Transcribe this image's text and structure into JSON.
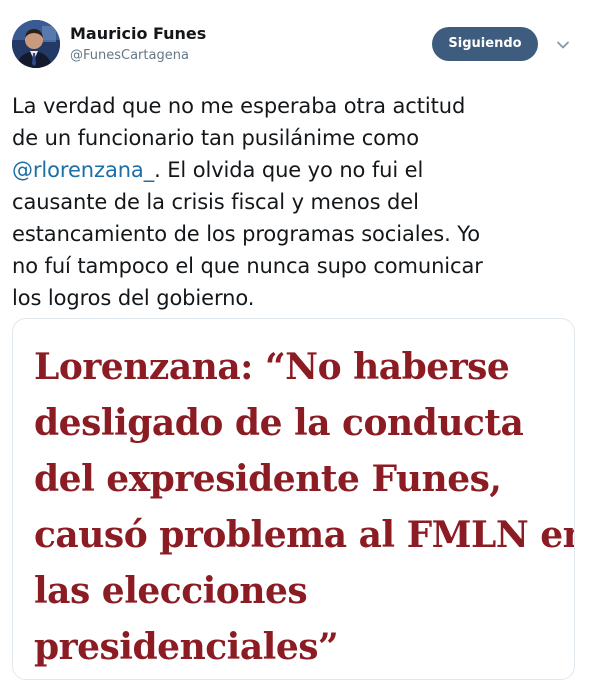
{
  "author": {
    "display_name": "Mauricio Funes",
    "handle": "@FunesCartagena"
  },
  "actions": {
    "follow_label": "Siguiendo",
    "menu_icon": "chevron-down-icon"
  },
  "tweet": {
    "lines": [
      "La verdad que no me esperaba otra actitud",
      "de un funcionario tan pusilánime como",
      "",
      "causante de la crisis fiscal y menos del",
      "estancamiento de los programas sociales. Yo",
      "no fuí tampoco el que nunca supo comunicar",
      "los logros del gobierno."
    ],
    "mention": "@rlorenzana_",
    "line3_rest": ". El olvida que yo no fui el"
  },
  "media": {
    "headline_lines": [
      "Lorenzana: “No haberse",
      "desligado de la conducta",
      "del expresidente Funes,",
      "causó problema al FMLN en",
      "las elecciones",
      "presidenciales”"
    ]
  },
  "colors": {
    "follow_button": "#3d5c7e",
    "mention": "#1b6fa8",
    "headline": "#8c1c23"
  }
}
